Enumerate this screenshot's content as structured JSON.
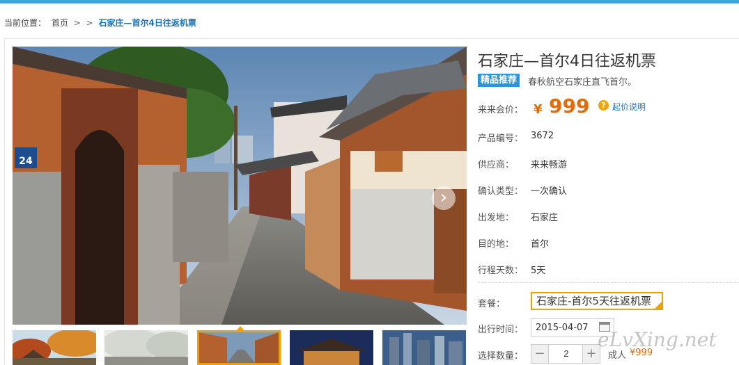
{
  "breadcrumb": {
    "prefix": "当前位置：",
    "home": "首页",
    "sep1": ">",
    "sep2": ">",
    "current": "石家庄—首尔4日往返机票"
  },
  "product": {
    "title": "石家庄—首尔4日往返机票",
    "badge": "精品推荐",
    "subtitle": "春秋航空石家庄直飞首尔。",
    "price_label": "来来会价：",
    "price_symbol": "¥",
    "price": "999",
    "price_note": "起价说明",
    "price_note_icon": "?",
    "fields": [
      {
        "label": "产品编号：",
        "value": "3672"
      },
      {
        "label": "供应商：",
        "value": "来来畅游"
      },
      {
        "label": "确认类型：",
        "value": "一次确认"
      },
      {
        "label": "出发地：",
        "value": "石家庄"
      },
      {
        "label": "目的地：",
        "value": "首尔"
      },
      {
        "label": "行程天数：",
        "value": "5天"
      }
    ]
  },
  "booking": {
    "package_label": "套餐：",
    "package_value": "石家庄-首尔5天往返机票",
    "date_label": "出行时间：",
    "date_value": "2015-04-07",
    "qty_label": "选择数量：",
    "qty_minus": "−",
    "qty_value": "2",
    "qty_plus": "+",
    "unit": "成人",
    "unit_price": "¥999"
  },
  "gallery": {
    "next_icon": "chevron-right-icon",
    "next_glyph": "›",
    "sign_text": "24"
  },
  "watermark": "eLvXing.net",
  "colors": {
    "accent": "#3ea7d9",
    "badge": "#2b95d6",
    "price": "#e26b0a",
    "highlight": "#f0a000",
    "link": "#1a73b5"
  }
}
